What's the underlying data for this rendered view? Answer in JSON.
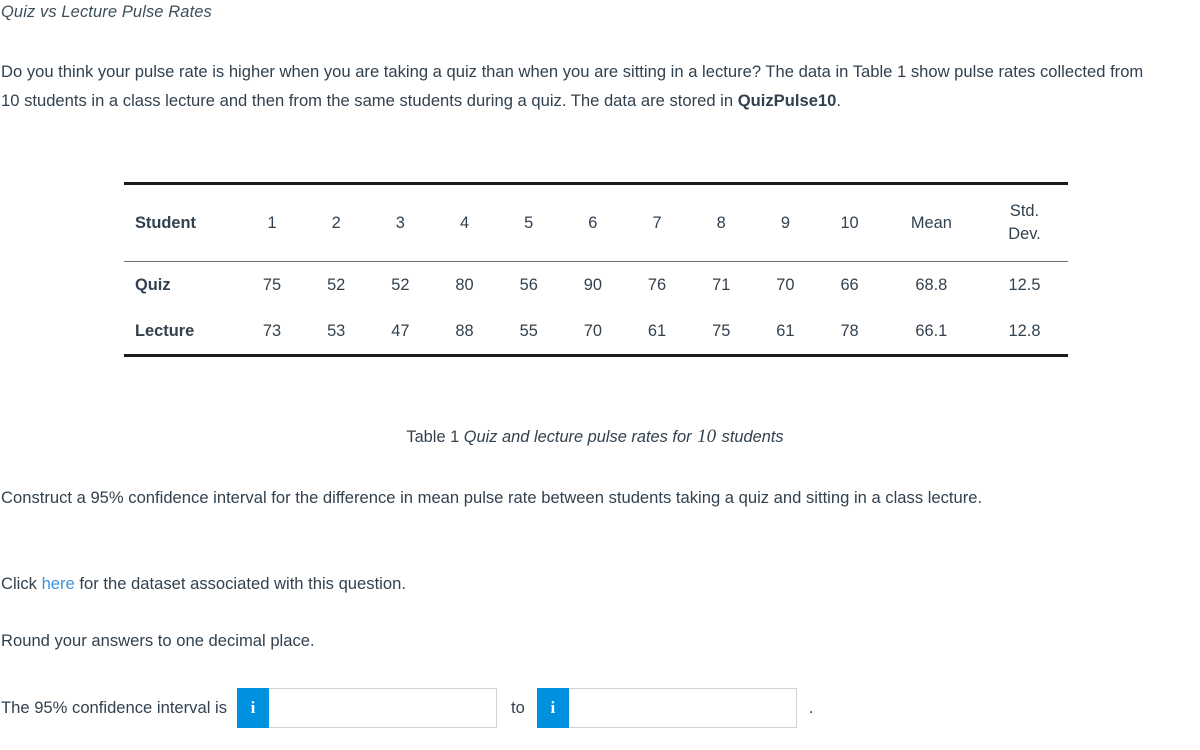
{
  "title": "Quiz vs Lecture Pulse Rates",
  "intro": {
    "text_before_bold": "Do you think your pulse rate is higher when you are taking a quiz than when you are sitting in a lecture? The data in Table 1 show pulse rates collected from 10 students in a class lecture and then from the same students during a quiz. The data are stored in ",
    "dataset_name": "QuizPulse10",
    "text_after_bold": "."
  },
  "table": {
    "corner_label": "Student",
    "student_numbers": [
      "1",
      "2",
      "3",
      "4",
      "5",
      "6",
      "7",
      "8",
      "9",
      "10"
    ],
    "mean_header": "Mean",
    "sd_header_line1": "Std.",
    "sd_header_line2": "Dev.",
    "rows": [
      {
        "label": "Quiz",
        "values": [
          "75",
          "52",
          "52",
          "80",
          "56",
          "90",
          "76",
          "71",
          "70",
          "66"
        ],
        "mean": "68.8",
        "sd": "12.5"
      },
      {
        "label": "Lecture",
        "values": [
          "73",
          "53",
          "47",
          "88",
          "55",
          "70",
          "61",
          "75",
          "61",
          "78"
        ],
        "mean": "66.1",
        "sd": "12.8"
      }
    ]
  },
  "caption": {
    "label": "Table 1 ",
    "text_before_number": "Quiz and lecture pulse rates for ",
    "number": "10",
    "text_after_number": " students"
  },
  "body": {
    "construct": "Construct a 95% confidence interval for the difference in mean pulse rate between students taking a quiz and sitting in a class lecture.",
    "click_before": "Click ",
    "click_link": "here",
    "click_after": " for the dataset associated with this question.",
    "round": "Round your answers to one decimal place."
  },
  "answer": {
    "label": "The 95% confidence interval is",
    "info_icon_glyph": "i",
    "lower_value": "",
    "upper_value": "",
    "lower_placeholder": "",
    "upper_placeholder": "",
    "connector": "to",
    "period": "."
  },
  "colors": {
    "accent_blue": "#0090e0",
    "link_blue": "#3d93dd",
    "text": "#32414f",
    "rule_dark": "#1b1b1b",
    "rule_light": "#6d6d6d"
  },
  "chart_data": {
    "type": "table",
    "title": "Table 1 Quiz and lecture pulse rates for 10 students",
    "categories": [
      "1",
      "2",
      "3",
      "4",
      "5",
      "6",
      "7",
      "8",
      "9",
      "10"
    ],
    "xlabel": "Student",
    "ylabel": "Pulse rate",
    "series": [
      {
        "name": "Quiz",
        "values": [
          75,
          52,
          52,
          80,
          56,
          90,
          76,
          71,
          70,
          66
        ],
        "mean": 68.8,
        "std_dev": 12.5
      },
      {
        "name": "Lecture",
        "values": [
          73,
          53,
          47,
          88,
          55,
          70,
          61,
          75,
          61,
          78
        ],
        "mean": 66.1,
        "std_dev": 12.8
      }
    ]
  }
}
